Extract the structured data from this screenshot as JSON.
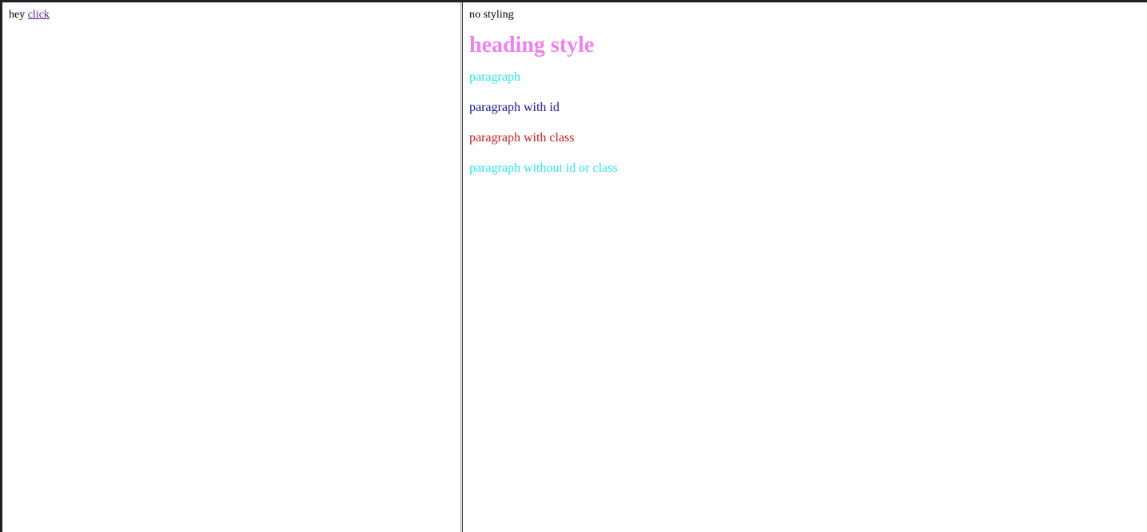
{
  "left_frame": {
    "text_prefix": "hey",
    "link_label": "click"
  },
  "right_frame": {
    "plain_text": "no styling",
    "heading": "heading style",
    "paragraphs": [
      {
        "text": "paragraph",
        "color": "#33e1ec"
      },
      {
        "text": "paragraph with id",
        "color": "#1a1a9e"
      },
      {
        "text": "paragraph with class",
        "color": "#c0231f"
      },
      {
        "text": "paragraph without id or class",
        "color": "#33e1ec"
      }
    ],
    "heading_color": "#ee82ee"
  },
  "colors": {
    "link": "#551a8b",
    "background": "#ffffff",
    "window_border": "#202124"
  }
}
